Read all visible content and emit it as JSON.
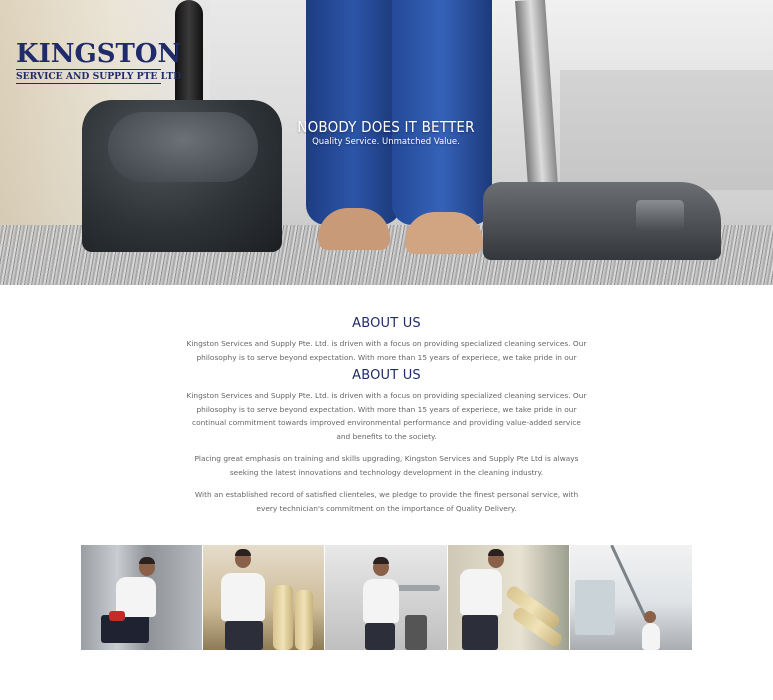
{
  "brand": {
    "name": "KINGSTON",
    "tagline": "SERVICE AND SUPPLY PTE LTD",
    "color": "#1f2b6b"
  },
  "hero": {
    "title": "NOBODY DOES IT BETTER",
    "subtitle": "Quality Service. Unmatched Value."
  },
  "about_partial": {
    "heading": "ABOUT US",
    "paragraph": "Kingston Services and Supply Pte. Ltd. is driven with a focus on providing specialized cleaning services. Our philosophy is to serve beyond expectation. With more than 15 years of experiece, we take pride in our continual"
  },
  "about": {
    "heading": "ABOUT US",
    "paragraphs": [
      "Kingston Services and Supply Pte. Ltd. is driven with a focus on providing specialized cleaning services. Our philosophy is to serve beyond expectation. With more than 15 years of experiece, we take pride in our continual commitment towards improved environmental performance and providing value-added service and benefits to the society.",
      "Placing great emphasis on training and skills upgrading, Kingston Services and Supply Pte Ltd is always seeking the latest innovations and technology development in the cleaning industry.",
      "With an established record of satisfied clienteles, we pledge to provide the finest personal service, with every technician's commitment on the importance of Quality Delivery."
    ]
  },
  "gallery": {
    "photos": [
      "cleaner-glass-door-photo",
      "cleaner-rolling-carpet-photo",
      "cleaner-office-photo",
      "cleaner-blinds-photo",
      "cleaner-window-photo"
    ]
  }
}
